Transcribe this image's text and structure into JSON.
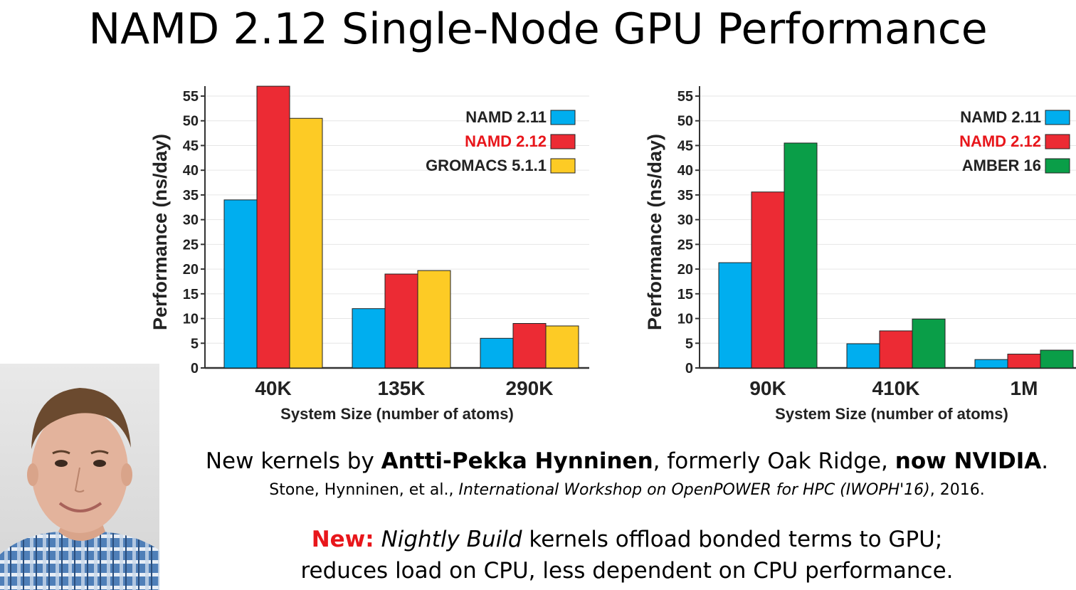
{
  "slide": {
    "title": "NAMD 2.12 Single-Node GPU Performance"
  },
  "chart_data": [
    {
      "type": "bar",
      "categories": [
        "40K",
        "135K",
        "290K"
      ],
      "series": [
        {
          "name": "NAMD 2.11",
          "values": [
            34,
            12,
            6
          ],
          "color": "#00aeef"
        },
        {
          "name": "NAMD 2.12",
          "values": [
            57,
            19,
            9
          ],
          "color": "#ec2b34"
        },
        {
          "name": "GROMACS 5.1.1",
          "values": [
            50.5,
            19.7,
            8.5
          ],
          "color": "#fdcb25"
        }
      ],
      "xlabel": "System Size (number of atoms)",
      "ylabel": "Performance (ns/day)",
      "ylim": [
        0,
        55
      ],
      "yticks": [
        0,
        5,
        10,
        15,
        20,
        25,
        30,
        35,
        40,
        45,
        50,
        55
      ],
      "grid": "horizontal",
      "legend": "top-right"
    },
    {
      "type": "bar",
      "categories": [
        "90K",
        "410K",
        "1M"
      ],
      "series": [
        {
          "name": "NAMD 2.11",
          "values": [
            21.3,
            4.9,
            1.7
          ],
          "color": "#00aeef"
        },
        {
          "name": "NAMD 2.12",
          "values": [
            35.6,
            7.5,
            2.8
          ],
          "color": "#ec2b34"
        },
        {
          "name": "AMBER 16",
          "values": [
            45.5,
            9.9,
            3.6
          ],
          "color": "#0a9e48"
        }
      ],
      "xlabel": "System Size (number of atoms)",
      "ylabel": "Performance (ns/day)",
      "ylim": [
        0,
        55
      ],
      "yticks": [
        0,
        5,
        10,
        15,
        20,
        25,
        30,
        35,
        40,
        45,
        50,
        55
      ],
      "grid": "horizontal",
      "legend": "top-right"
    }
  ],
  "credit": {
    "prefix": "New kernels by ",
    "author": "Antti-Pekka Hynninen",
    "middle": ", formerly Oak Ridge, ",
    "affiliation": "now NVIDIA",
    "end": "."
  },
  "citation": {
    "authors": "Stone, Hynninen, et al., ",
    "venue": "International Workshop on OpenPOWER for HPC (IWOPH'16)",
    "year": ", 2016."
  },
  "news": {
    "label": "New:",
    "build": "Nightly Build",
    "line1_rest": " kernels offload bonded terms to GPU;",
    "line2": "reduces load on CPU, less dependent on CPU performance."
  },
  "photo": {
    "icon": "portrait-photo"
  }
}
